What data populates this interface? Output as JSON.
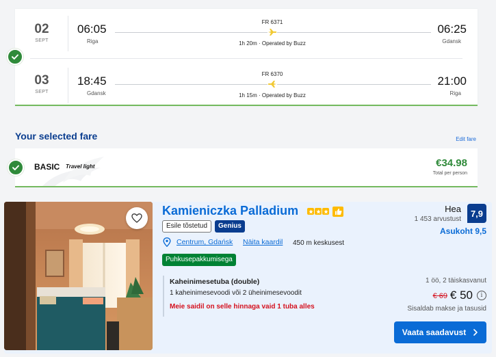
{
  "flights": {
    "legs": [
      {
        "day": "02",
        "month": "SEPT",
        "dep_time": "06:05",
        "dep_city": "Riga",
        "flight_no": "FR 6371",
        "duration": "1h 20m · Operated by Buzz",
        "arr_time": "06:25",
        "arr_city": "Gdansk"
      },
      {
        "day": "03",
        "month": "SEPT",
        "dep_time": "18:45",
        "dep_city": "Gdansk",
        "flight_no": "FR 6370",
        "duration": "1h 15m · Operated by Buzz",
        "arr_time": "21:00",
        "arr_city": "Riga"
      }
    ]
  },
  "fare": {
    "heading": "Your selected fare",
    "edit_link": "Edit fare",
    "name": "BASIC",
    "subtitle": "Travel light",
    "price": "€34.98",
    "price_note": "Total per person"
  },
  "hotel": {
    "name": "Kamieniczka Palladium",
    "star_count": 3,
    "tag_featured": "Esile tõstetud",
    "tag_genius": "Genius",
    "location": "Centrum, Gdańsk",
    "map_link": "Näita kaardil",
    "distance": "450 m keskusest",
    "deal": "Puhkusepakkumisega",
    "room_name": "Kaheinimesetuba (double)",
    "room_beds": "1 kaheinimesevoodi või 2 üheinimesevoodit",
    "room_warning": "Meie saidil on selle hinnaga vaid 1 tuba alles",
    "rating_word": "Hea",
    "review_count": "1 453 arvustust",
    "score": "7,9",
    "location_score": "Asukoht 9,5",
    "stay_info": "1 öö, 2 täiskasvanut",
    "old_price": "€ 69",
    "new_price": "€ 50",
    "tax_note": "Sisaldab makse ja tasusid",
    "cta_label": "Vaata saadavust"
  },
  "colors": {
    "brand_blue": "#0a3d8f",
    "link_blue": "#0a6bd6",
    "success_green": "#2f8a3a",
    "deal_green": "#008234",
    "warning_red": "#d4111e",
    "star_yellow": "#febb02"
  }
}
